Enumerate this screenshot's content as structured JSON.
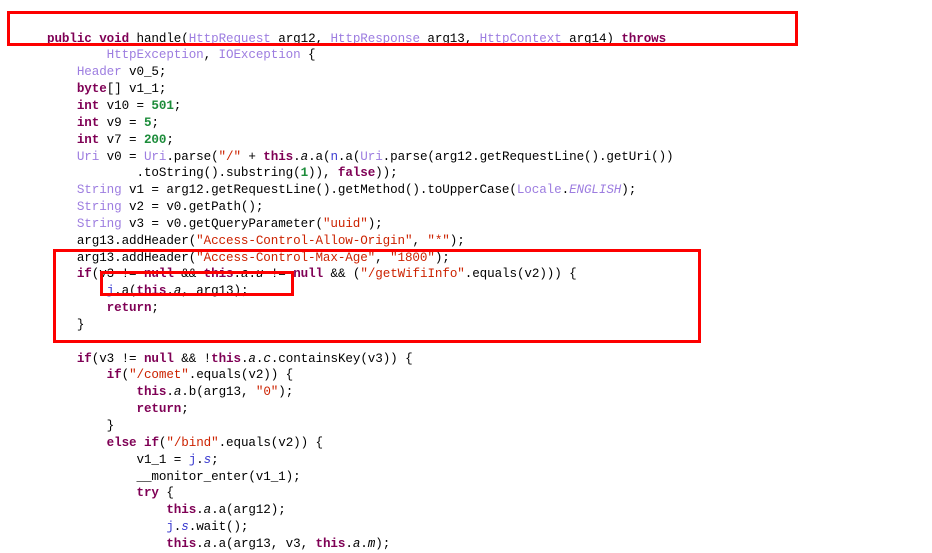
{
  "view": {
    "kind": "decompiled-java-source-view",
    "background_color": "#ffffff",
    "text_color": "#000000"
  },
  "syntax_colors": {
    "keyword": "#7f0055",
    "type": "#9d7de0",
    "number": "#1c8c3a",
    "string": "#cc2200",
    "field_ref": "#3b3bd0",
    "plain": "#000000",
    "annotation_box": "#fd0000"
  },
  "annotations": [
    {
      "name": "method-signature-highlight",
      "label": "public void handle(HttpRequest arg12, HttpResponse arg13, HttpContext arg14) throws HttpException, IOException {"
    },
    {
      "name": "getwifiinfo-block-highlight",
      "label": "if(v3 != null && this.a.u != null && (\"/getWifiInfo\".equals(v2))) { ... }"
    },
    {
      "name": "sink-call-highlight",
      "label": "j.a(this.a, arg13);"
    }
  ],
  "code": {
    "lines": [
      "    public void handle(HttpRequest arg12, HttpResponse arg13, HttpContext arg14) throws",
      "            HttpException, IOException {",
      "        Header v0_5;",
      "        byte[] v1_1;",
      "        int v10 = 501;",
      "        int v9 = 5;",
      "        int v7 = 200;",
      "        Uri v0 = Uri.parse(\"/\" + this.a.a(n.a(Uri.parse(arg12.getRequestLine().getUri())",
      "                .toString().substring(1)), false));",
      "        String v1 = arg12.getRequestLine().getMethod().toUpperCase(Locale.ENGLISH);",
      "        String v2 = v0.getPath();",
      "        String v3 = v0.getQueryParameter(\"uuid\");",
      "        arg13.addHeader(\"Access-Control-Allow-Origin\", \"*\");",
      "        arg13.addHeader(\"Access-Control-Max-Age\", \"1800\");",
      "        if(v3 != null && this.a.u != null && (\"/getWifiInfo\".equals(v2))) {",
      "            j.a(this.a, arg13);",
      "            return;",
      "        }",
      "",
      "        if(v3 != null && !this.a.c.containsKey(v3)) {",
      "            if(\"/comet\".equals(v2)) {",
      "                this.a.b(arg13, \"0\");",
      "                return;",
      "            }",
      "            else if(\"/bind\".equals(v2)) {",
      "                v1_1 = j.s;",
      "                __monitor_enter(v1_1);",
      "                try {",
      "                    this.a.a(arg12);",
      "                    j.s.wait();",
      "                    this.a.a(arg13, v3, this.a.m);"
    ],
    "line_count": 30,
    "first_visible_line": "    public void handle(HttpRequest arg12, HttpResponse arg13, HttpContext arg14) throws",
    "last_visible_line": "                    this.a.a(arg13, v3, this.a.m);"
  }
}
